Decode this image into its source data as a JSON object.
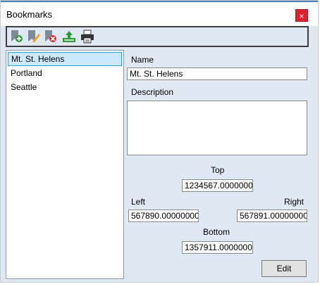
{
  "window": {
    "title": "Bookmarks",
    "close_label": "×"
  },
  "toolbar": {
    "buttons": [
      {
        "icon": "add-bookmark-icon",
        "tooltip": ""
      },
      {
        "icon": "edit-bookmark-icon",
        "tooltip": ""
      },
      {
        "icon": "delete-bookmark-icon",
        "tooltip": ""
      },
      {
        "icon": "import-export-icon",
        "tooltip": ""
      },
      {
        "icon": "print-icon",
        "tooltip": ""
      }
    ]
  },
  "bookmarks": {
    "items": [
      "Mt. St. Helens",
      "Portland",
      "Seattle"
    ],
    "selected_index": 0
  },
  "details": {
    "name_label": "Name",
    "name_value": "Mt. St. Helens",
    "description_label": "Description",
    "description_value": "",
    "top_label": "Top",
    "top_value": "1234567.0000000",
    "left_label": "Left",
    "left_value": "567890.00000000",
    "right_label": "Right",
    "right_value": "567891.00000000",
    "bottom_label": "Bottom",
    "bottom_value": "1357911.0000000",
    "edit_button": "Edit"
  },
  "colors": {
    "window_bg": "#dfe8f3",
    "selection_bg": "#cce8ff",
    "selection_border": "#26a0da",
    "close_bg": "#d9232f"
  }
}
